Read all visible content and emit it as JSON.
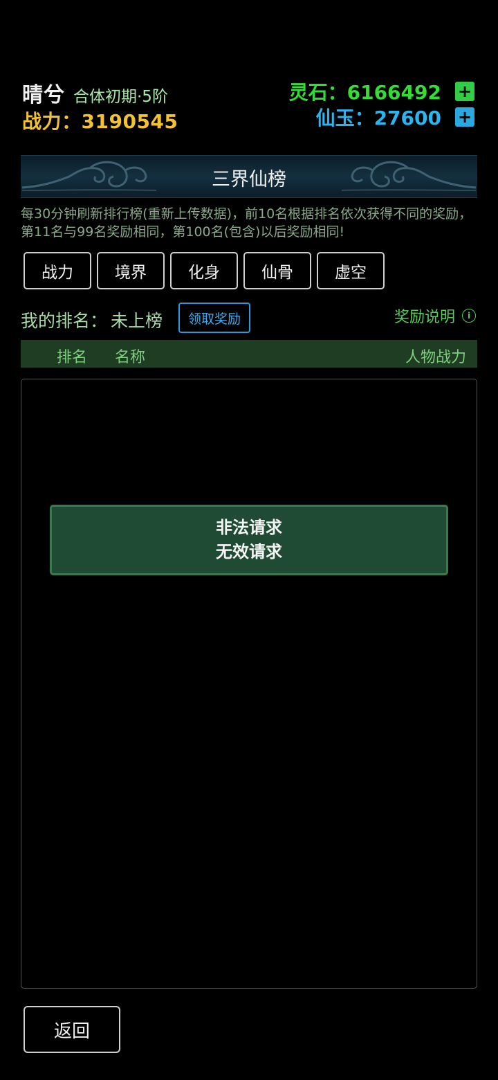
{
  "player": {
    "name": "晴兮",
    "realm": "合体初期·5阶",
    "power_label": "战力：",
    "power_value": "3190545"
  },
  "resources": {
    "spirit_stone": {
      "label": "灵石：",
      "value": "6166492",
      "plus_label": "+"
    },
    "immortal_jade": {
      "label": "仙玉：",
      "value": "27600",
      "plus_label": "+"
    }
  },
  "banner": {
    "title": "三界仙榜"
  },
  "description": "每30分钟刷新排行榜(重新上传数据)，前10名根据排名依次获得不同的奖励，第11名与99名奖励相同，第100名(包含)以后奖励相同!",
  "tabs": [
    {
      "label": "战力"
    },
    {
      "label": "境界"
    },
    {
      "label": "化身"
    },
    {
      "label": "仙骨"
    },
    {
      "label": "虚空"
    }
  ],
  "my_rank": {
    "label": "我的排名：",
    "value": "未上榜",
    "claim_button": "领取奖励"
  },
  "reward_info": {
    "label": "奖励说明",
    "icon": "info-icon",
    "icon_glyph": "i"
  },
  "table": {
    "headers": {
      "rank": "排名",
      "name": "名称",
      "power": "人物战力"
    }
  },
  "toast": {
    "line1": "非法请求",
    "line2": "无效请求"
  },
  "back_button": "返回",
  "colors": {
    "background": "#000000",
    "gold": "#f2c230",
    "green": "#33dd33",
    "blue": "#2bb5f0",
    "table_header_bg": "#1f3d22",
    "toast_bg": "#1f4a33"
  }
}
